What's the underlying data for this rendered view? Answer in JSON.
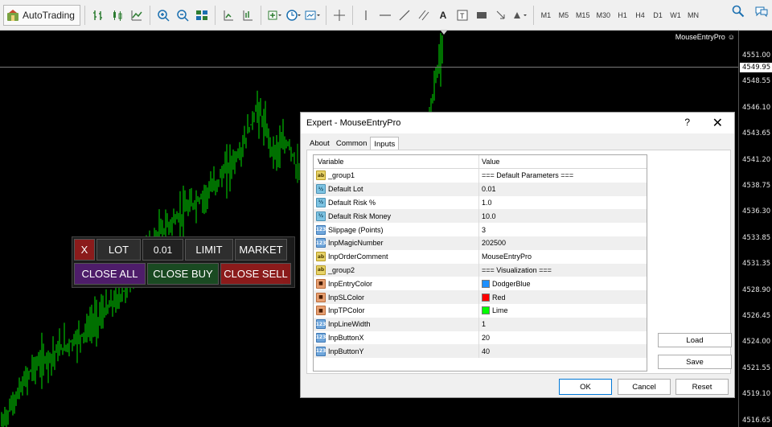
{
  "toolbar": {
    "autotrading_label": "AutoTrading",
    "timeframes": [
      "M1",
      "M5",
      "M15",
      "M30",
      "H1",
      "H4",
      "D1",
      "W1",
      "MN"
    ]
  },
  "chart": {
    "ea_name": "MouseEntryPro",
    "current_price": "4549.95",
    "price_ticks": [
      "4551.00",
      "4548.55",
      "4546.10",
      "4543.65",
      "4541.20",
      "4538.75",
      "4536.30",
      "4533.85",
      "4531.35",
      "4528.90",
      "4526.45",
      "4524.00",
      "4521.55",
      "4519.10",
      "4516.65"
    ],
    "candle_color": "#00e000"
  },
  "panel": {
    "x_label": "X",
    "lot_label": "LOT",
    "lot_value": "0.01",
    "limit_label": "LIMIT",
    "market_label": "MARKET",
    "close_all_label": "CLOSE ALL",
    "close_buy_label": "CLOSE BUY",
    "close_sell_label": "CLOSE SELL"
  },
  "dialog": {
    "title": "Expert - MouseEntryPro",
    "help": "?",
    "close": "✕",
    "tabs": [
      "About",
      "Common",
      "Inputs"
    ],
    "active_tab": "Inputs",
    "columns": [
      "Variable",
      "Value"
    ],
    "rows": [
      {
        "icon": "ab",
        "name": "_group1",
        "value": "=== Default Parameters ==="
      },
      {
        "icon": "ve",
        "name": "Default Lot",
        "value": "0.01"
      },
      {
        "icon": "ve",
        "name": "Default Risk %",
        "value": "1.0"
      },
      {
        "icon": "ve",
        "name": "Default Risk Money",
        "value": "10.0"
      },
      {
        "icon": "123",
        "name": "Slippage (Points)",
        "value": "3"
      },
      {
        "icon": "123",
        "name": "InpMagicNumber",
        "value": "202500"
      },
      {
        "icon": "ab",
        "name": "InpOrderComment",
        "value": "MouseEntryPro"
      },
      {
        "icon": "ab",
        "name": "_group2",
        "value": "=== Visualization ==="
      },
      {
        "icon": "clr",
        "name": "InpEntryColor",
        "value": "DodgerBlue",
        "swatch": "#1e90ff"
      },
      {
        "icon": "clr",
        "name": "InpSLColor",
        "value": "Red",
        "swatch": "#ff0000"
      },
      {
        "icon": "clr",
        "name": "InpTPColor",
        "value": "Lime",
        "swatch": "#00ff00"
      },
      {
        "icon": "123",
        "name": "InpLineWidth",
        "value": "1"
      },
      {
        "icon": "123",
        "name": "InpButtonX",
        "value": "20"
      },
      {
        "icon": "123",
        "name": "InpButtonY",
        "value": "40"
      }
    ],
    "load_label": "Load",
    "save_label": "Save",
    "ok_label": "OK",
    "cancel_label": "Cancel",
    "reset_label": "Reset"
  }
}
